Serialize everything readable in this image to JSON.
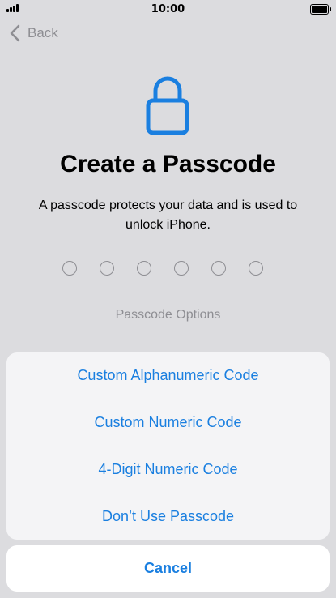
{
  "status_bar": {
    "time": "10:00",
    "signal_icon": "signal-icon",
    "battery_icon": "battery-icon"
  },
  "nav": {
    "back_label": "Back",
    "back_icon": "chevron-left-icon"
  },
  "main": {
    "lock_icon": "lock-icon",
    "title": "Create a Passcode",
    "subtitle": "A passcode protects your data and is used to unlock iPhone.",
    "passcode_dots": 6,
    "options_label": "Passcode Options"
  },
  "action_sheet": {
    "items": [
      {
        "label": "Custom Alphanumeric Code"
      },
      {
        "label": "Custom Numeric Code"
      },
      {
        "label": "4-Digit Numeric Code"
      },
      {
        "label": "Don’t Use Passcode"
      }
    ],
    "cancel_label": "Cancel"
  },
  "colors": {
    "accent": "#1a7fe0",
    "secondary_text": "#8e8e93",
    "background": "#dcdcdf",
    "sheet_background": "#f4f4f6"
  }
}
